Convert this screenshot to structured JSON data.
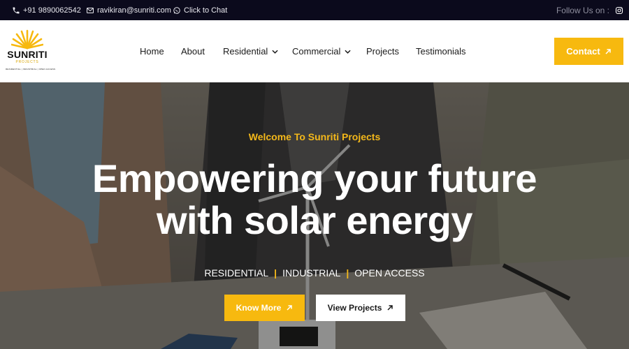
{
  "topbar": {
    "phone": "+91 9890062542",
    "email": "ravikiran@sunriti.com",
    "chat": "Click to Chat",
    "follow_label": "Follow Us on :"
  },
  "logo": {
    "brand": "SUNRITI",
    "sub": "PROJECTS",
    "tagline": "RESIDENTIAL | INDUSTRIAL | OPEN ACCESS"
  },
  "nav": {
    "items": [
      {
        "label": "Home"
      },
      {
        "label": "About"
      },
      {
        "label": "Residential"
      },
      {
        "label": "Commercial"
      },
      {
        "label": "Projects"
      },
      {
        "label": "Testimonials"
      }
    ],
    "contact_label": "Contact"
  },
  "hero": {
    "welcome": "Welcome To Sunriti Projects",
    "headline_line1": "Empowering your future",
    "headline_line2": "with solar energy",
    "segments": [
      "RESIDENTIAL",
      "INDUSTRIAL",
      "OPEN ACCESS"
    ],
    "separator": "|",
    "know_more_label": "Know More",
    "view_projects_label": "View Projects"
  },
  "colors": {
    "accent": "#f7b90f",
    "topbar_bg": "#0b0a1c",
    "text_dark": "#1a1a1a"
  },
  "icons": {
    "phone": "phone-icon",
    "email": "envelope-icon",
    "chat": "whatsapp-icon",
    "instagram": "instagram-icon",
    "arrow": "arrow-up-right-icon",
    "chevron": "chevron-down-icon"
  }
}
